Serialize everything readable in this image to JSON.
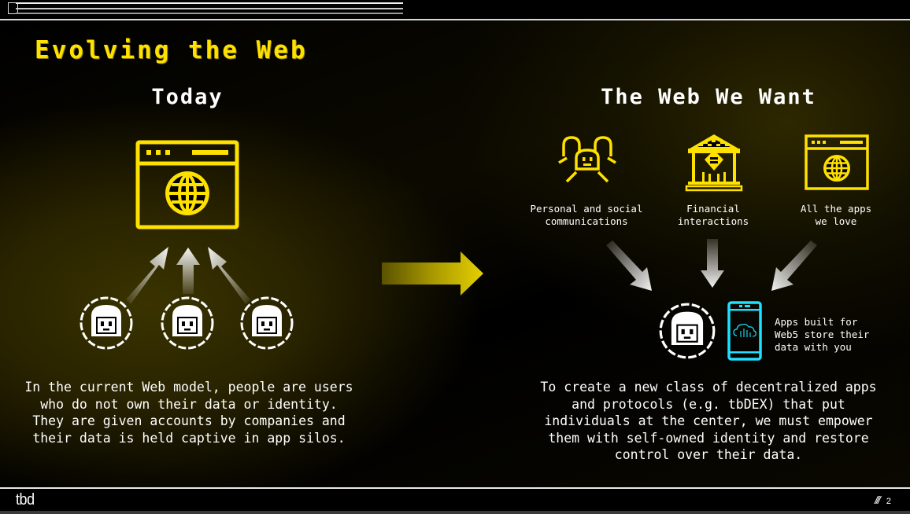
{
  "slide": {
    "title": "Evolving the Web",
    "page_number": "2",
    "footer_logo": "tbd",
    "footer_mark": "///"
  },
  "today": {
    "heading": "Today",
    "icon": "browser-globe-icon",
    "users": [
      "user-avatar-icon",
      "user-avatar-icon",
      "user-avatar-icon"
    ],
    "description": "In the current Web model, people are users who do not own their data or identity. They are given accounts by companies and their data is held captive in app silos."
  },
  "transition": {
    "icon": "arrow-right-icon"
  },
  "future": {
    "heading": "The Web We Want",
    "items": [
      {
        "icon": "social-people-icon",
        "label_line1": "Personal and social",
        "label_line2": "communications"
      },
      {
        "icon": "bank-icon",
        "label_line1": "Financial",
        "label_line2": "interactions"
      },
      {
        "icon": "browser-globe-icon",
        "label_line1": "All the apps",
        "label_line2": "we love"
      }
    ],
    "center_icons": [
      "user-avatar-icon",
      "phone-cloud-icon"
    ],
    "side_caption": [
      "Apps built for",
      "Web5 store their",
      "data with you"
    ],
    "description": "To create a new class of decentralized apps and protocols (e.g. tbDEX) that put individuals at the center, we must empower them with self-owned identity and restore control over their data."
  },
  "colors": {
    "accent_yellow": "#ffe100",
    "cyan": "#1ee0ff",
    "text": "#ffffff",
    "background": "#000000"
  }
}
